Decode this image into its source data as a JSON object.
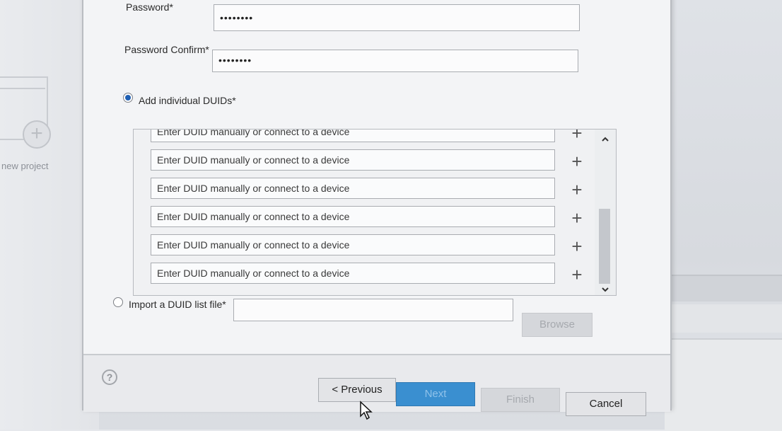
{
  "background": {
    "left_label": "new project"
  },
  "form": {
    "password_label": "Password*",
    "password_value": "••••••••",
    "password_confirm_label": "Password Confirm*",
    "password_confirm_value": "••••••••",
    "add_individual_label": "Add individual DUIDs*",
    "add_individual_selected": true,
    "duid_placeholder": "Enter DUID manually or connect to a device",
    "duid_rows": [
      "Enter DUID manually or connect to a device",
      "Enter DUID manually or connect to a device",
      "Enter DUID manually or connect to a device",
      "Enter DUID manually or connect to a device",
      "Enter DUID manually or connect to a device",
      "Enter DUID manually or connect to a device"
    ],
    "import_label": "Import a DUID list file*",
    "import_selected": false,
    "browse_label": "Browse"
  },
  "footer": {
    "help_icon": "?",
    "previous_label": "< Previous",
    "next_label": "Next",
    "finish_label": "Finish",
    "cancel_label": "Cancel"
  },
  "icons": {
    "plus": "+",
    "chevron_up": "^",
    "chevron_down": "v"
  },
  "colors": {
    "accent": "#3a8fd0",
    "dialog_bg": "#f3f4f6"
  }
}
